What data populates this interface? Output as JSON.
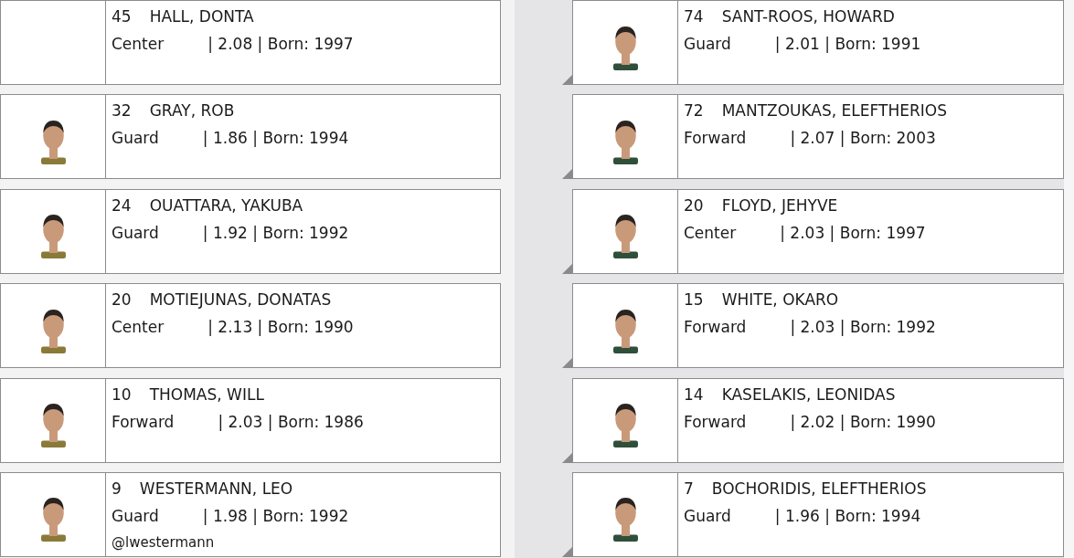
{
  "columns": [
    {
      "players": [
        {
          "number": "45",
          "name": "HALL, DONTA",
          "position": "Center",
          "details": "| 2.08 | Born: 1997",
          "photo": false
        },
        {
          "number": "32",
          "name": "GRAY, ROB",
          "position": "Guard",
          "details": "| 1.86 | Born: 1994",
          "photo": true
        },
        {
          "number": "24",
          "name": "OUATTARA, YAKUBA",
          "position": "Guard",
          "details": "| 1.92 | Born: 1992",
          "photo": true
        },
        {
          "number": "20",
          "name": "MOTIEJUNAS, DONATAS",
          "position": "Center",
          "details": "| 2.13 | Born: 1990",
          "photo": true
        },
        {
          "number": "10",
          "name": "THOMAS, WILL",
          "position": "Forward",
          "details": "| 2.03 | Born: 1986",
          "photo": true
        },
        {
          "number": "9",
          "name": "WESTERMANN, LEO",
          "position": "Guard",
          "details": "| 1.98 | Born: 1992",
          "photo": true,
          "handle": "@lwestermann"
        }
      ]
    },
    {
      "players": [
        {
          "number": "74",
          "name": "SANT-ROOS, HOWARD",
          "position": "Guard",
          "details": "| 2.01 | Born: 1991",
          "photo": true
        },
        {
          "number": "72",
          "name": "MANTZOUKAS, ELEFTHERIOS",
          "position": "Forward",
          "details": "| 2.07 | Born: 2003",
          "photo": true
        },
        {
          "number": "20",
          "name": "FLOYD, JEHYVE",
          "position": "Center",
          "details": "| 2.03 | Born: 1997",
          "photo": true
        },
        {
          "number": "15",
          "name": "WHITE, OKARO",
          "position": "Forward",
          "details": "| 2.03 | Born: 1992",
          "photo": true
        },
        {
          "number": "14",
          "name": "KASELAKIS, LEONIDAS",
          "position": "Forward",
          "details": "| 2.02 | Born: 1990",
          "photo": true
        },
        {
          "number": "7",
          "name": "BOCHORIDIS, ELEFTHERIOS",
          "position": "Guard",
          "details": "| 1.96 | Born: 1994",
          "photo": true
        }
      ]
    }
  ]
}
